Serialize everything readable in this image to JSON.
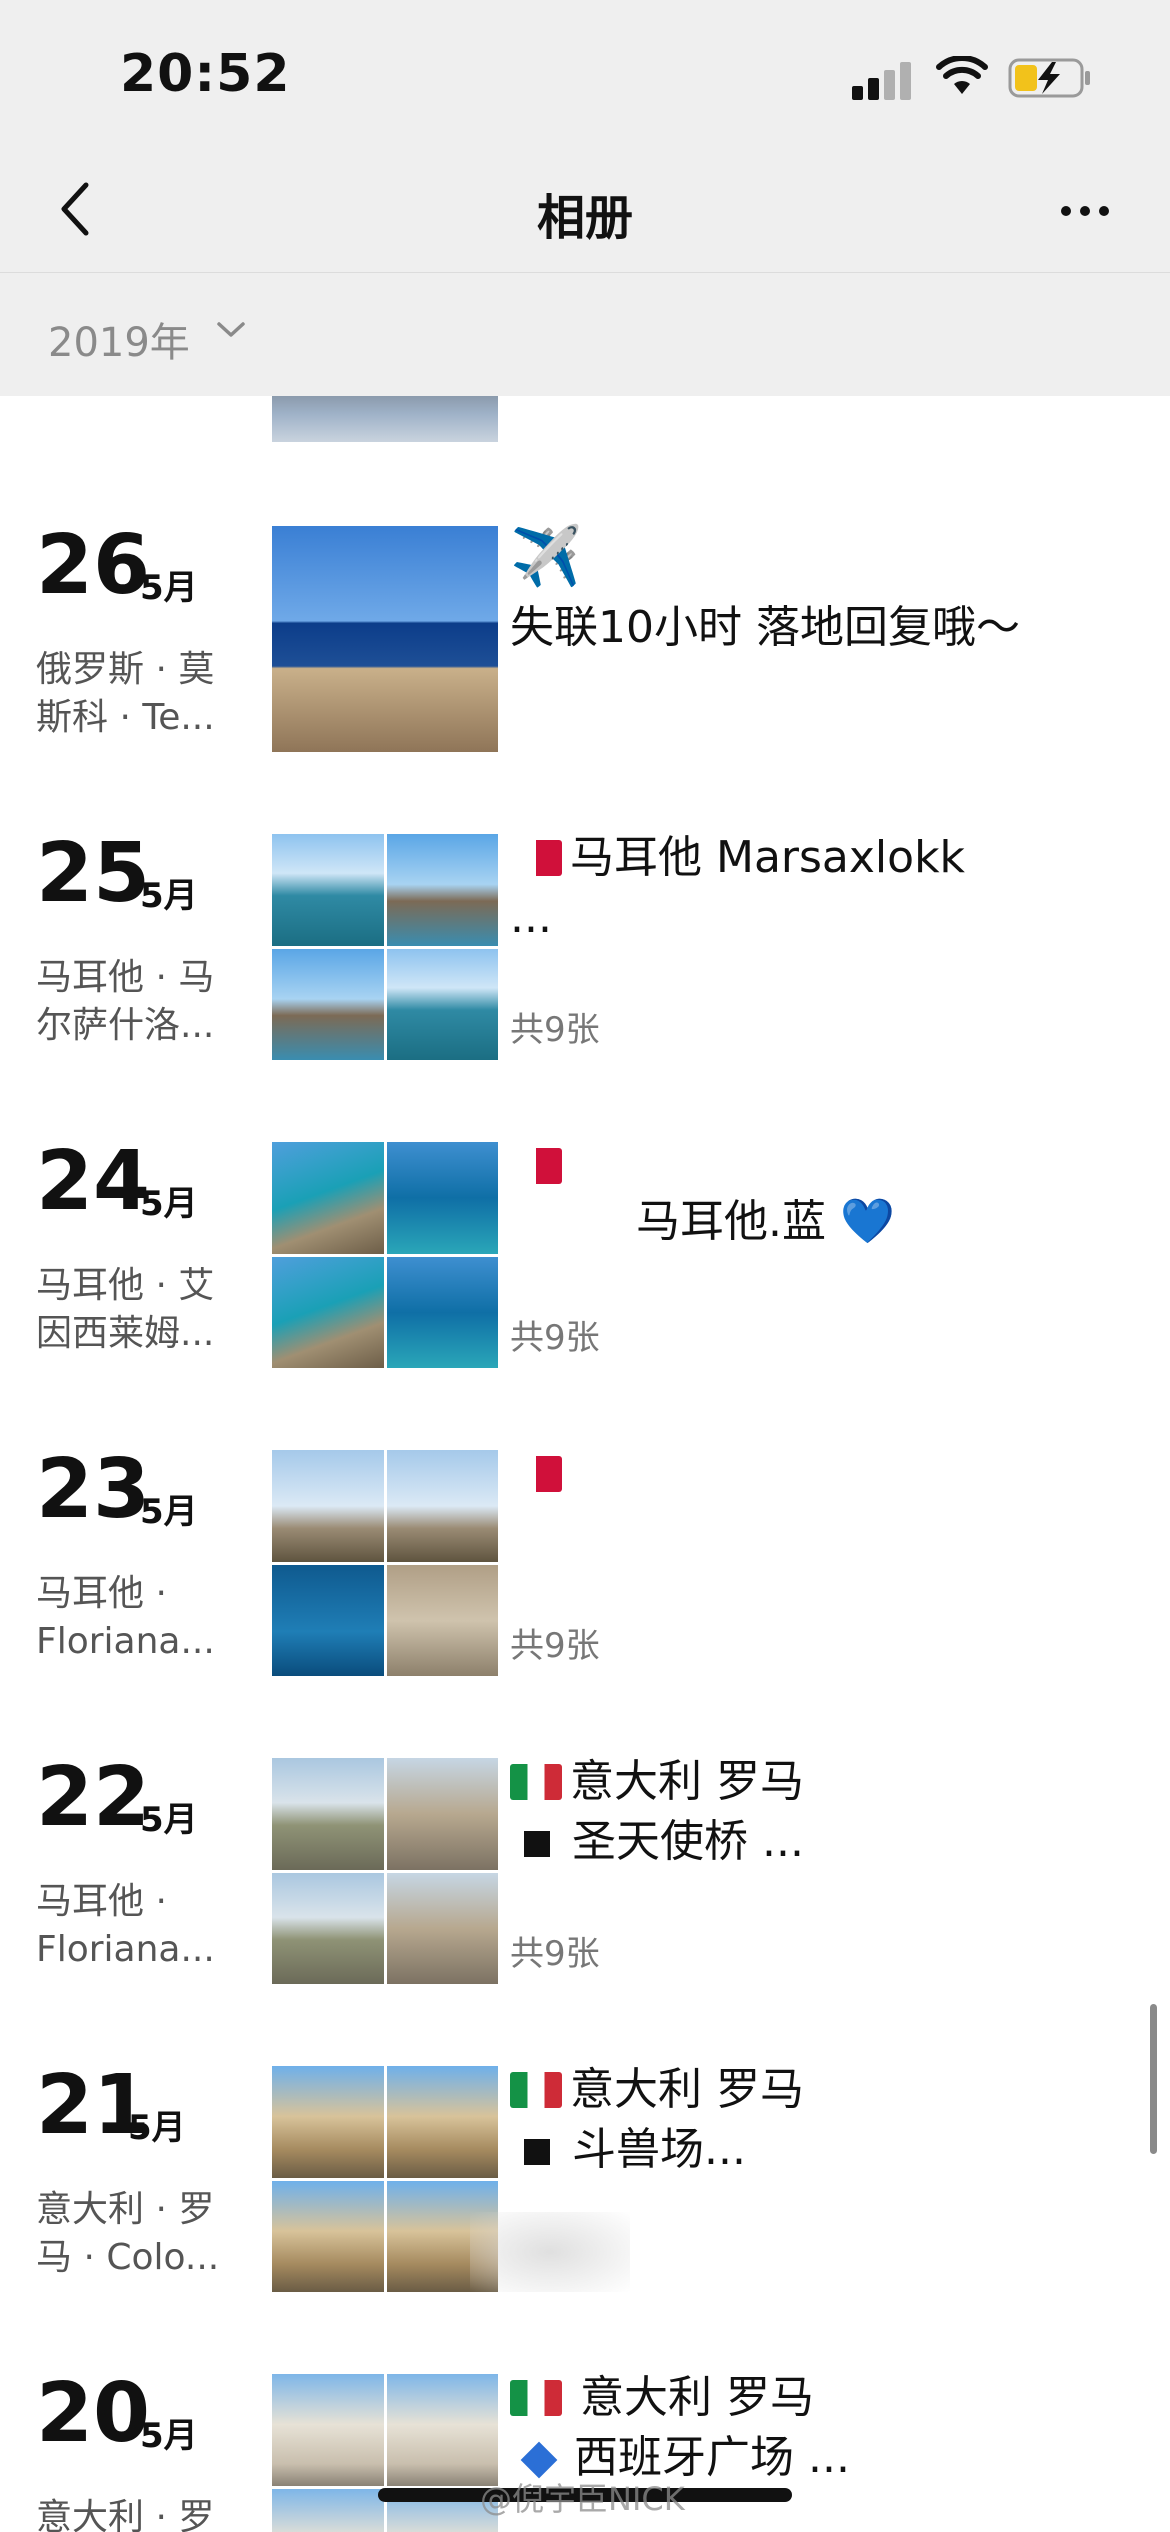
{
  "status_bar": {
    "time": "20:52"
  },
  "nav": {
    "title": "相册"
  },
  "year_filter": {
    "label": "2019年"
  },
  "entries": [
    {
      "day": "26",
      "month": "5月",
      "location": "俄罗斯 · 莫\n斯科 · Te...",
      "line1_emoji": "✈️",
      "line2": "失联10小时 落地回复哦～",
      "count": ""
    },
    {
      "day": "25",
      "month": "5月",
      "location": "马耳他 · 马\n尔萨什洛...",
      "line1": "马耳他 Marsaxlokk",
      "line2": "...",
      "count": "共9张"
    },
    {
      "day": "24",
      "month": "5月",
      "location": "马耳他 · 艾\n因西莱姆...",
      "line2": "马耳他.蓝",
      "line2_emoji": "💙",
      "count": "共9张"
    },
    {
      "day": "23",
      "month": "5月",
      "location": "马耳他 ·\nFloriana...",
      "count": "共9张"
    },
    {
      "day": "22",
      "month": "5月",
      "location": "马耳他 ·\nFloriana...",
      "line1": "意大利 罗马",
      "line2": "圣天使桥 ...",
      "count": "共9张"
    },
    {
      "day": "21",
      "month": "5月",
      "location": "意大利 · 罗\n马 · Colo...",
      "line1": "意大利 罗马",
      "line2": "斗兽场...",
      "count": ""
    },
    {
      "day": "20",
      "month": "5月",
      "location": "意大利 · 罗",
      "line1": "意大利 罗马",
      "line2": "西班牙广场 ...",
      "count": ""
    }
  ],
  "watermark": "@倪宇臣NICK",
  "icons": {
    "back": "chevron-left-icon",
    "more": "more-dots-icon",
    "year_dropdown": "chevron-down-icon",
    "flag_malta": "malta-flag-icon",
    "flag_italy": "italy-flag-icon"
  }
}
